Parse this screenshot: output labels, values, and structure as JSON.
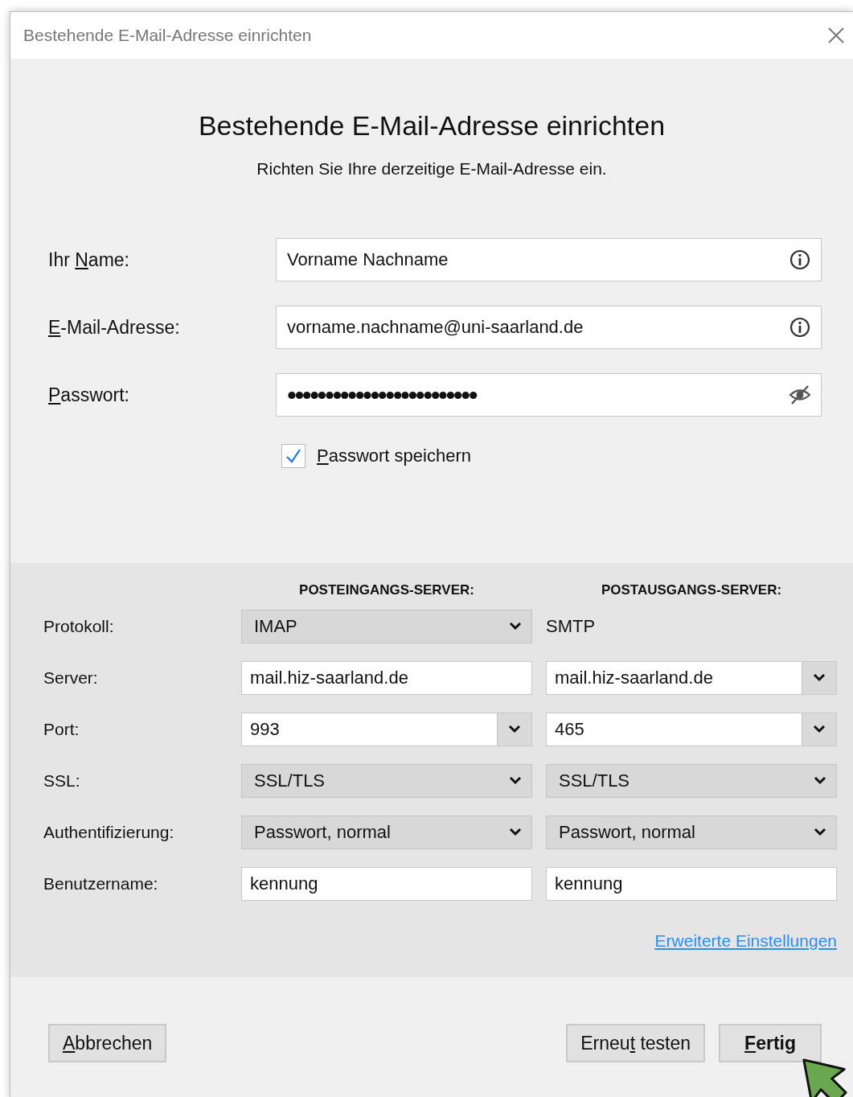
{
  "window": {
    "title": "Bestehende E-Mail-Adresse einrichten"
  },
  "heading": "Bestehende E-Mail-Adresse einrichten",
  "subheading": "Richten Sie Ihre derzeitige E-Mail-Adresse ein.",
  "fields": [
    {
      "label": {
        "pre": "Ihr ",
        "key": "N",
        "post": "ame:"
      },
      "value": "Vorname Nachname",
      "kind": "info"
    },
    {
      "label": {
        "key": "E",
        "post": "-Mail-Adresse:"
      },
      "value": "vorname.nachname@uni-saarland.de",
      "kind": "info"
    },
    {
      "label": {
        "key": "P",
        "post": "asswort:"
      },
      "value": "•••••••••••••••••••••••••",
      "kind": "password"
    }
  ],
  "remember_password": {
    "label": {
      "key": "P",
      "post": "asswort speichern"
    },
    "checked": true
  },
  "servers": {
    "headers": [
      "POSTEINGANGS-SERVER:",
      "POSTAUSGANGS-SERVER:"
    ],
    "rows": [
      {
        "label": "Protokoll:",
        "cells": [
          {
            "kind": "dropdown",
            "value": "IMAP"
          },
          {
            "kind": "text",
            "value": "SMTP"
          }
        ]
      },
      {
        "label": "Server:",
        "cells": [
          {
            "kind": "input",
            "value": "mail.hiz-saarland.de"
          },
          {
            "kind": "combo",
            "value": "mail.hiz-saarland.de"
          }
        ]
      },
      {
        "label": "Port:",
        "cells": [
          {
            "kind": "combo",
            "value": "993"
          },
          {
            "kind": "combo",
            "value": "465"
          }
        ]
      },
      {
        "label": "SSL:",
        "cells": [
          {
            "kind": "dropdown",
            "value": "SSL/TLS"
          },
          {
            "kind": "dropdown",
            "value": "SSL/TLS"
          }
        ]
      },
      {
        "label": "Authentifizierung:",
        "cells": [
          {
            "kind": "dropdown",
            "value": "Passwort, normal"
          },
          {
            "kind": "dropdown",
            "value": "Passwort, normal"
          }
        ]
      },
      {
        "label": "Benutzername:",
        "cells": [
          {
            "kind": "input",
            "value": "kennung"
          },
          {
            "kind": "input",
            "value": "kennung"
          }
        ]
      }
    ],
    "advanced_link": {
      "key": "E",
      "post": "rweiterte Einstellungen"
    }
  },
  "buttons": [
    {
      "label": {
        "key": "A",
        "post": "bbrechen"
      },
      "default": false
    },
    {
      "label": {
        "pre": "Erneu",
        "key": "t",
        "post": " testen"
      },
      "default": false
    },
    {
      "label": {
        "key": "F",
        "post": "ertig"
      },
      "default": true
    }
  ],
  "pointer": {
    "kind": "arrow"
  }
}
